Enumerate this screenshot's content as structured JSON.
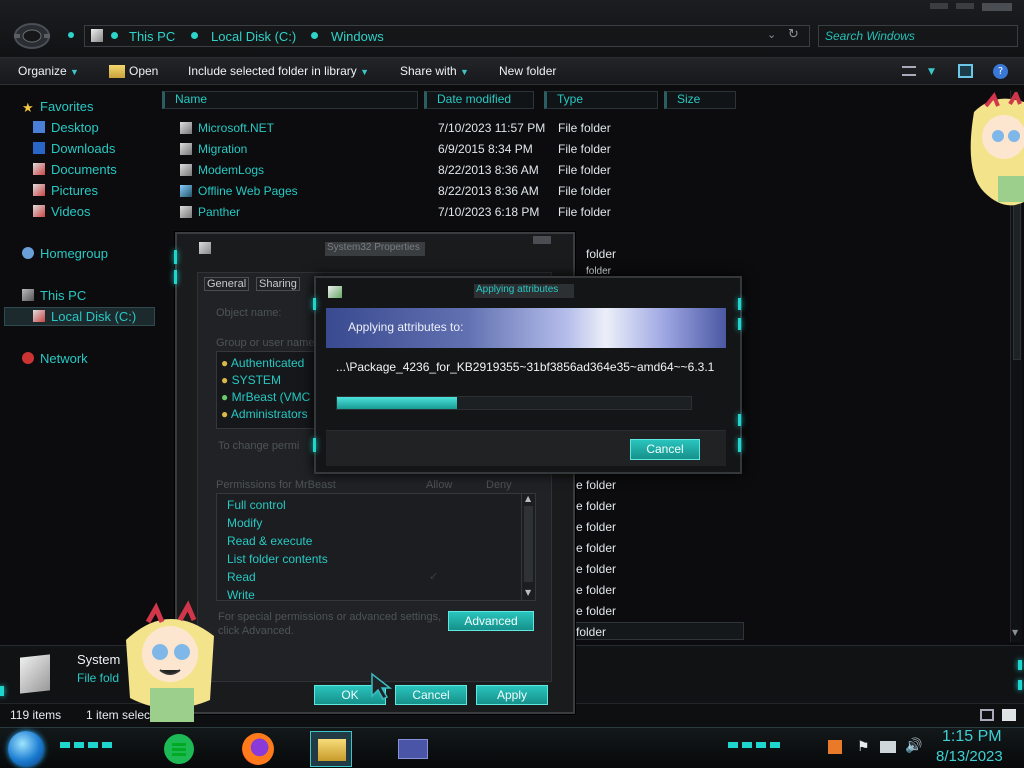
{
  "explorer": {
    "breadcrumb": [
      "This PC",
      "Local Disk (C:)",
      "Windows"
    ],
    "search_placeholder": "Search Windows",
    "toolbar": {
      "organize": "Organize",
      "open": "Open",
      "include_library": "Include selected folder in library",
      "share_with": "Share with",
      "new_folder": "New folder"
    },
    "nav": {
      "favorites": "Favorites",
      "desktop": "Desktop",
      "downloads": "Downloads",
      "documents": "Documents",
      "pictures": "Pictures",
      "videos": "Videos",
      "homegroup": "Homegroup",
      "this_pc": "This PC",
      "local_disk": "Local Disk (C:)",
      "network": "Network"
    },
    "columns": {
      "name": "Name",
      "date": "Date modified",
      "type": "Type",
      "size": "Size"
    },
    "files": [
      {
        "name": "Microsoft.NET",
        "date": "7/10/2023 11:57 PM",
        "type": "File folder"
      },
      {
        "name": "Migration",
        "date": "6/9/2015 8:34 PM",
        "type": "File folder"
      },
      {
        "name": "ModemLogs",
        "date": "8/22/2013 8:36 AM",
        "type": "File folder"
      },
      {
        "name": "Offline Web Pages",
        "date": "8/22/2013 8:36 AM",
        "type": "File folder"
      },
      {
        "name": "Panther",
        "date": "7/10/2023 6:18 PM",
        "type": "File folder"
      }
    ],
    "type_fragments": [
      "e folder",
      "e folder",
      "e folder",
      "e folder",
      "e folder",
      "e folder",
      "e folder",
      "e folder",
      "folder"
    ],
    "type_fragments_top": [
      "folder",
      "folder"
    ],
    "details": {
      "name": "System",
      "type": "File fold"
    },
    "status": {
      "count": "119 items",
      "selected": "1 item selec"
    }
  },
  "properties": {
    "title": "System32 Properties",
    "tabs": [
      "General",
      "Sharing"
    ],
    "object_name_label": "Object name:",
    "group_label": "Group or user names:",
    "users": [
      "Authenticated",
      "SYSTEM",
      "MrBeast (VMC",
      "Administrators"
    ],
    "change_perm": "To change permi",
    "perm_label": "Permissions for MrBeast",
    "allow": "Allow",
    "deny": "Deny",
    "permissions": [
      "Full control",
      "Modify",
      "Read & execute",
      "List folder contents",
      "Read",
      "Write"
    ],
    "special_note_1": "For special permissions or advanced settings,",
    "special_note_2": "click Advanced.",
    "advanced_btn": "Advanced",
    "ok_btn": "OK",
    "cancel_btn": "Cancel",
    "apply_btn": "Apply"
  },
  "applying": {
    "title": "Applying attributes",
    "header": "Applying attributes to:",
    "path": "...\\Package_4236_for_KB2919355~31bf3856ad364e35~amd64~~6.3.1",
    "progress": 0.34,
    "cancel_btn": "Cancel"
  },
  "taskbar": {
    "time": "1:15 PM",
    "date": "8/13/2023"
  },
  "colors": {
    "accent": "#27c9c4",
    "bg": "#0c0c0e"
  }
}
